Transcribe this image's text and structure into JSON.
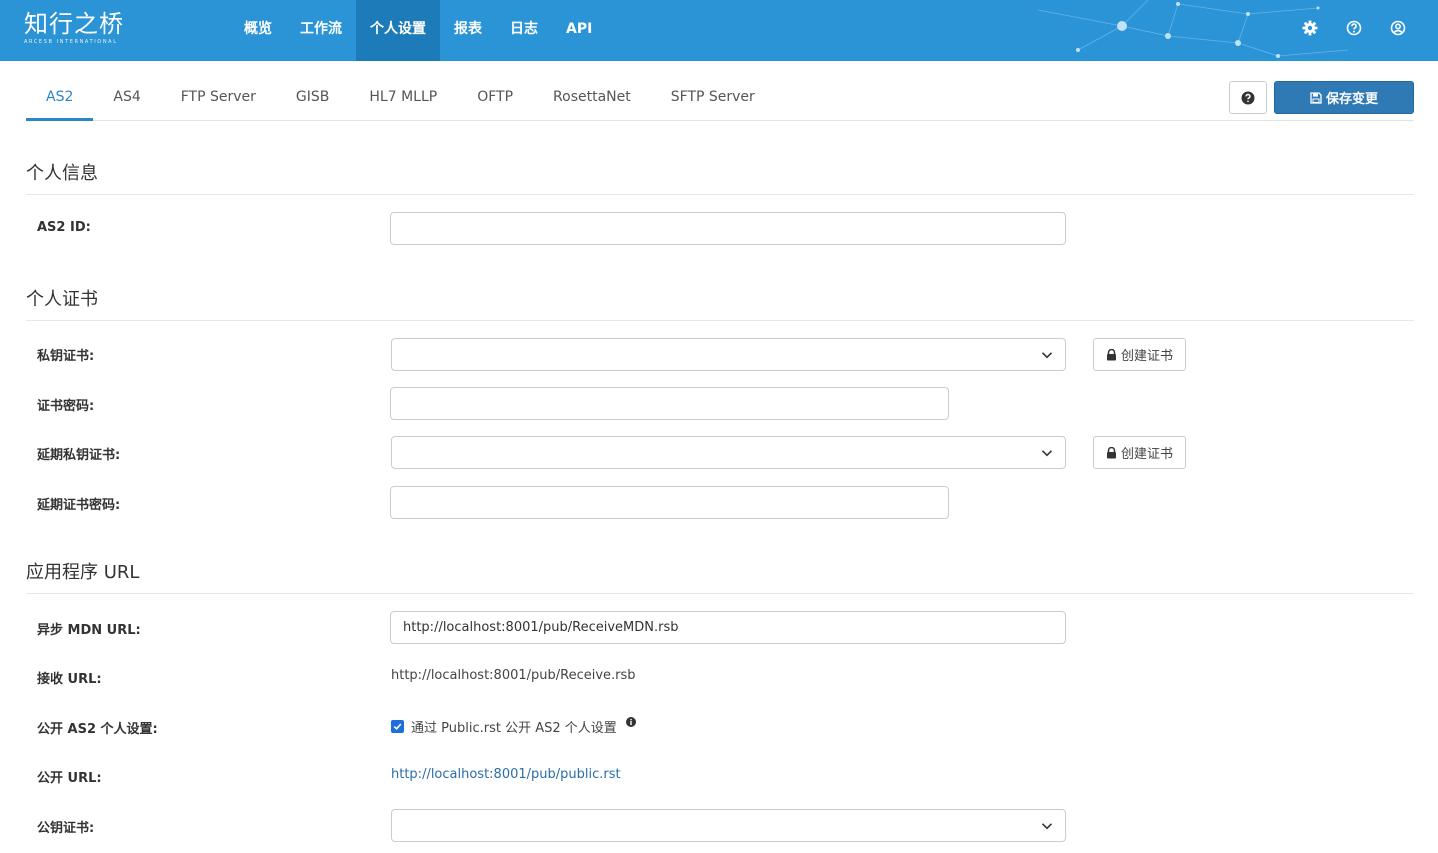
{
  "app": {
    "logo_text": "知行之桥",
    "logo_subtext": "ARCESB INTERNATIONAL"
  },
  "nav": {
    "items": [
      {
        "label": "概览",
        "active": false
      },
      {
        "label": "工作流",
        "active": false
      },
      {
        "label": "个人设置",
        "active": true
      },
      {
        "label": "报表",
        "active": false
      },
      {
        "label": "日志",
        "active": false
      },
      {
        "label": "API",
        "active": false
      }
    ],
    "icons": [
      "gear-icon",
      "help-circle-icon",
      "user-circle-icon"
    ]
  },
  "tabs": {
    "items": [
      {
        "label": "AS2",
        "active": true
      },
      {
        "label": "AS4",
        "active": false
      },
      {
        "label": "FTP Server",
        "active": false
      },
      {
        "label": "GISB",
        "active": false
      },
      {
        "label": "HL7 MLLP",
        "active": false
      },
      {
        "label": "OFTP",
        "active": false
      },
      {
        "label": "RosettaNet",
        "active": false
      },
      {
        "label": "SFTP Server",
        "active": false
      }
    ],
    "save_label": "保存变更"
  },
  "sections": {
    "personal_info": {
      "title": "个人信息",
      "as2_id_label": "AS2 ID:",
      "as2_id_value": ""
    },
    "personal_cert": {
      "title": "个人证书",
      "private_cert_label": "私钥证书:",
      "private_cert_value": "",
      "cert_password_label": "证书密码:",
      "deferred_private_cert_label": "延期私钥证书:",
      "deferred_cert_password_label": "延期证书密码:",
      "create_cert_label": "创建证书"
    },
    "app_url": {
      "title": "应用程序 URL",
      "async_mdn_label": "异步 MDN URL:",
      "async_mdn_value": "http://localhost:8001/pub/ReceiveMDN.rsb",
      "receive_url_label": "接收 URL:",
      "receive_url_value": "http://localhost:8001/pub/Receive.rsb",
      "public_profile_label": "公开 AS2 个人设置:",
      "public_profile_checkbox_label": "通过 Public.rst 公开 AS2 个人设置",
      "public_profile_checked": true,
      "public_url_label": "公开 URL:",
      "public_url_value": "http://localhost:8001/pub/public.rst",
      "public_cert_label": "公钥证书:"
    }
  },
  "colors": {
    "navbar": "#2a94d6",
    "nav_active": "#1c7bb8",
    "tab_active": "#2a87c6",
    "save_button": "#2f79b5",
    "link": "#2a6ea8"
  }
}
